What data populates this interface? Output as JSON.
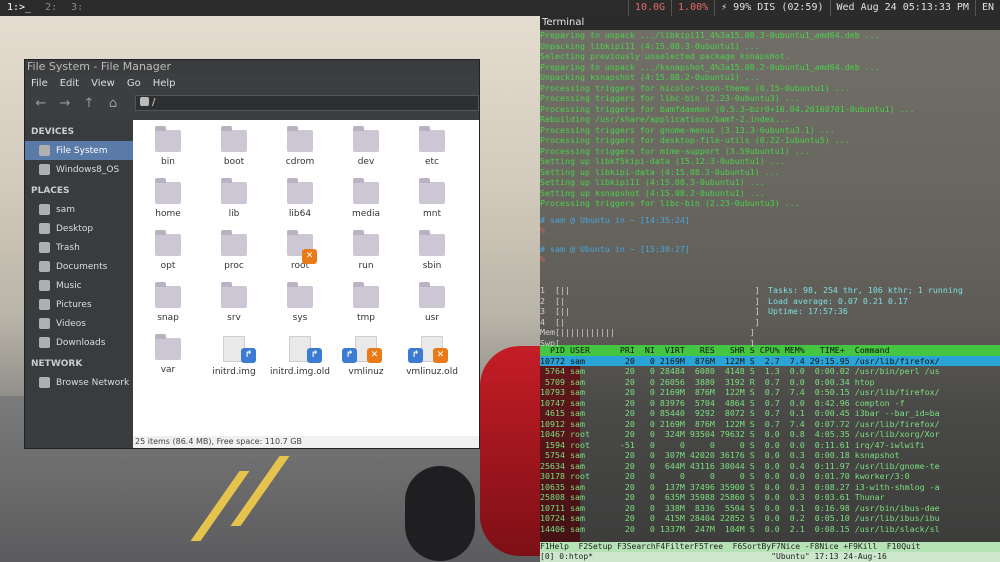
{
  "topbar": {
    "workspaces": [
      {
        "label": "1:>_",
        "active": true
      },
      {
        "label": "2:",
        "active": false
      },
      {
        "label": "3:",
        "active": false
      }
    ],
    "status": [
      "10.0G",
      "1.00%",
      "⚡ 99% DIS (02:59)",
      "Wed Aug 24 05:13:33 PM",
      "EN"
    ]
  },
  "filemanager": {
    "title": "File System - File Manager",
    "menu": [
      "File",
      "Edit",
      "View",
      "Go",
      "Help"
    ],
    "path": "/",
    "sections": [
      {
        "title": "DEVICES",
        "items": [
          "File System",
          "Windows8_OS"
        ]
      },
      {
        "title": "PLACES",
        "items": [
          "sam",
          "Desktop",
          "Trash",
          "Documents",
          "Music",
          "Pictures",
          "Videos",
          "Downloads"
        ]
      },
      {
        "title": "NETWORK",
        "items": [
          "Browse Network"
        ]
      }
    ],
    "items": [
      {
        "name": "bin",
        "type": "folder"
      },
      {
        "name": "boot",
        "type": "folder"
      },
      {
        "name": "cdrom",
        "type": "folder"
      },
      {
        "name": "dev",
        "type": "folder"
      },
      {
        "name": "etc",
        "type": "folder"
      },
      {
        "name": "home",
        "type": "folder"
      },
      {
        "name": "lib",
        "type": "folder"
      },
      {
        "name": "lib64",
        "type": "folder"
      },
      {
        "name": "media",
        "type": "folder"
      },
      {
        "name": "mnt",
        "type": "folder"
      },
      {
        "name": "opt",
        "type": "folder"
      },
      {
        "name": "proc",
        "type": "folder"
      },
      {
        "name": "root",
        "type": "folder",
        "badge": "x"
      },
      {
        "name": "run",
        "type": "folder"
      },
      {
        "name": "sbin",
        "type": "folder"
      },
      {
        "name": "snap",
        "type": "folder"
      },
      {
        "name": "srv",
        "type": "folder"
      },
      {
        "name": "sys",
        "type": "folder"
      },
      {
        "name": "tmp",
        "type": "folder"
      },
      {
        "name": "usr",
        "type": "folder"
      },
      {
        "name": "var",
        "type": "folder"
      },
      {
        "name": "initrd.img",
        "type": "link"
      },
      {
        "name": "initrd.img.old",
        "type": "link"
      },
      {
        "name": "vmlinuz",
        "type": "linkx"
      },
      {
        "name": "vmlinuz.old",
        "type": "linkx"
      }
    ],
    "status": "25 items (86.4 MB), Free space: 110.7 GB"
  },
  "terminal": {
    "title": "Terminal",
    "lines": [
      "Preparing to unpack .../libkipi11_4%3a15.08.3-0ubuntu1_amd64.deb ...",
      "Unpacking libkipi11 (4:15.08.3-0ubuntu1) ...",
      "Selecting previously unselected package ksnapshot.",
      "Preparing to unpack .../ksnapshot_4%3a15.08.2-0ubuntu1_amd64.deb ...",
      "Unpacking ksnapshot (4:15.08.2-0ubuntu1) ...",
      "Processing triggers for hicolor-icon-theme (0.15-0ubuntu1) ...",
      "Processing triggers for libc-bin (2.23-0ubuntu3) ...",
      "Processing triggers for bamfdaemon (0.5.3~bzr0+16.04.20160701-0ubuntu1) ...",
      "Rebuilding /usr/share/applications/bamf-2.index...",
      "Processing triggers for gnome-menus (3.13.3-6ubuntu3.1) ...",
      "Processing triggers for desktop-file-utils (0.22-1ubuntu5) ...",
      "Processing triggers for mime-support (3.59ubuntu1) ...",
      "Setting up libkf5kipi-data (15.12.3-0ubuntu1) ...",
      "Setting up libkipi-data (4:15.08.3-0ubuntu1) ...",
      "Setting up libkipi11 (4:15.08.3-0ubuntu1) ...",
      "Setting up ksnapshot (4:15.08.2-0ubuntu1) ...",
      "Processing triggers for libc-bin (2.23-0ubuntu3) ..."
    ],
    "prompts": [
      "# sam @ Ubuntu in ~ [14:35:24]",
      "%",
      "# sam @ Ubuntu in ~ [15:30:27]",
      "%"
    ],
    "htop_meters": [
      "1  [||                                     ]",
      "2  [|                                      ]",
      "3  [||                                     ]",
      "4  [|                                      ]",
      "Mem[|||||||||||                           ]",
      "Swp[                                      ]"
    ],
    "htop_info": [
      "Tasks: 98, 254 thr, 106 kthr; 1 running",
      "Load average: 0.07 0.21 0.17",
      "Uptime: 17:57:36"
    ],
    "htop_header": "  PID USER      PRI  NI  VIRT   RES   SHR S CPU% MEM%   TIME+  Command",
    "htop_rows": [
      "10772 sam        20   0 2169M  876M  122M S  2.7  7.4 29:15.95 /usr/lib/firefox/",
      " 5764 sam        20   0 28484  6080  4148 S  1.3  0.0  0:00.02 /usr/bin/perl /us",
      " 5709 sam        20   0 26056  3880  3192 R  0.7  0.0  0:00.34 htop",
      "10793 sam        20   0 2169M  876M  122M S  0.7  7.4  0:50.15 /usr/lib/firefox/",
      "10747 sam        20   0 83976  5704  4864 S  0.7  0.0  0:42.96 compton -f",
      " 4615 sam        20   0 85440  9292  8072 S  0.7  0.1  0:00.45 i3bar --bar_id=ba",
      "10912 sam        20   0 2169M  876M  122M S  0.7  7.4  0:07.72 /usr/lib/firefox/",
      "10467 root       20   0  324M 93504 79632 S  0.0  0.8  4:05.35 /usr/lib/xorg/Xor",
      " 1594 root      -51   0     0     0     0 S  0.0  0.0  0:11.61 irq/47-iwlwifi",
      " 5754 sam        20   0  307M 42020 36176 S  0.0  0.3  0:00.18 ksnapshot",
      "25634 sam        20   0  644M 43116 30044 S  0.0  0.4  0:11.97 /usr/lib/gnome-te",
      "30178 root       20   0     0     0     0 S  0.0  0.0  0:01.70 kworker/3:0",
      "10635 sam        20   0  137M 37496 35900 S  0.0  0.3  0:08.27 i3-with-shmlog -a",
      "25808 sam        20   0  635M 35988 25860 S  0.0  0.3  0:03.61 Thunar",
      "10711 sam        20   0  338M  8336  5504 S  0.0  0.1  0:16.98 /usr/bin/ibus-dae",
      "10724 sam        20   0  415M 28404 22852 S  0.0  0.2  0:05.10 /usr/lib/ibus/ibu",
      "14406 sam        20   0 1337M  247M  104M S  0.0  2.1  0:08.15 /usr/lib/slack/sl"
    ],
    "htop_footer": "F1Help  F2Setup F3SearchF4FilterF5Tree  F6SortByF7Nice -F8Nice +F9Kill  F10Quit",
    "tmux_bar": "[0] 0:htop*                                     \"Ubuntu\" 17:13 24-Aug-16"
  },
  "colors": {
    "accent": "#5a7aa8",
    "term_green": "#49d34a",
    "htop_header": "#45c643",
    "htop_select": "#2aa4d6"
  }
}
